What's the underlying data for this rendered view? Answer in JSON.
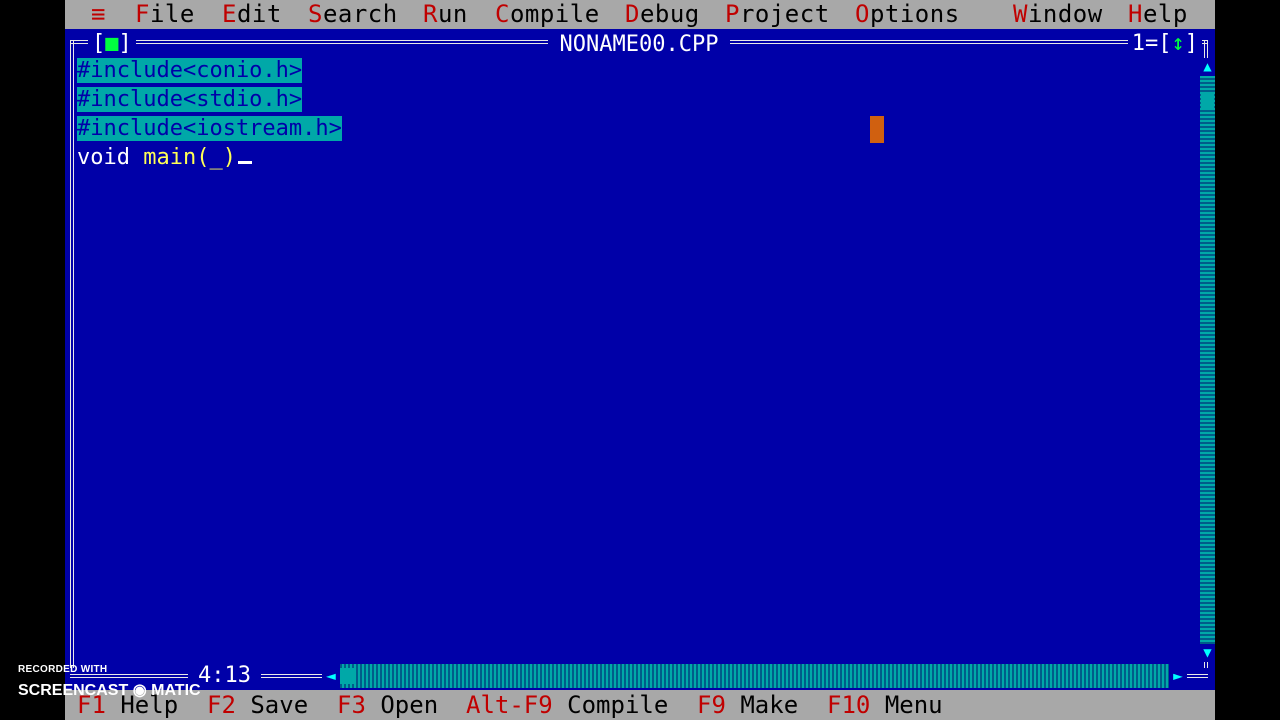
{
  "menu": [
    {
      "hot": "≡",
      "rest": ""
    },
    {
      "hot": "F",
      "rest": "ile"
    },
    {
      "hot": "E",
      "rest": "dit"
    },
    {
      "hot": "S",
      "rest": "earch"
    },
    {
      "hot": "R",
      "rest": "un"
    },
    {
      "hot": "C",
      "rest": "ompile"
    },
    {
      "hot": "D",
      "rest": "ebug"
    },
    {
      "hot": "P",
      "rest": "roject"
    },
    {
      "hot": "O",
      "rest": "ptions"
    },
    {
      "hot": "W",
      "rest": "indow"
    },
    {
      "hot": "H",
      "rest": "elp"
    }
  ],
  "window": {
    "title": "NONAME00.CPP",
    "close_left": "[",
    "close_mark": "■",
    "close_right": "]",
    "number": "1=[",
    "zoom_mark": "↕",
    "number_end": "]"
  },
  "editor": {
    "lines": [
      "#include<conio.h>",
      "#include<stdio.h>",
      "#include<iostream.h>"
    ],
    "code_keyword": "void",
    "code_ident": "main(_)"
  },
  "status": {
    "position": "4:13"
  },
  "scroll": {
    "up": "▲",
    "down": "▼",
    "left": "◄",
    "right": "►"
  },
  "fkeys": [
    {
      "key": "F1",
      "label": "Help"
    },
    {
      "key": "F2",
      "label": "Save"
    },
    {
      "key": "F3",
      "label": "Open"
    },
    {
      "key": "Alt-F9",
      "label": "Compile"
    },
    {
      "key": "F9",
      "label": "Make"
    },
    {
      "key": "F10",
      "label": "Menu"
    }
  ],
  "watermark": {
    "line1": "RECORDED WITH",
    "line2": "SCREENCAST",
    "line3": "MATIC"
  },
  "colors": {
    "editor_bg": "#0000a8",
    "menu_bg": "#a8a8a8",
    "hotkey": "#c00000",
    "selection": "#00a8a8"
  }
}
